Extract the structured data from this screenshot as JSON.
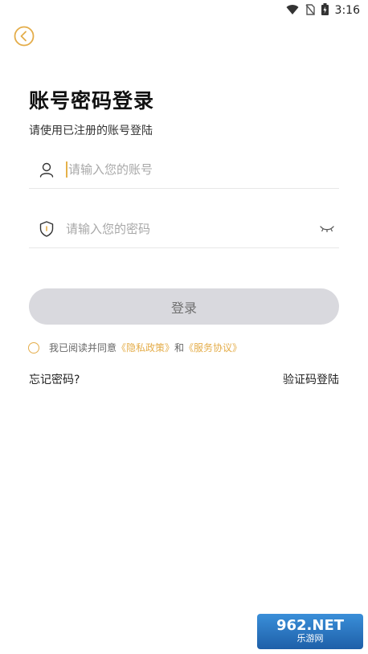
{
  "status_bar": {
    "time": "3:16",
    "icons": [
      "wifi-icon",
      "no-sim-icon",
      "battery-charging-icon"
    ]
  },
  "header": {
    "back_icon": "chevron-left-circle-icon"
  },
  "page": {
    "title": "账号密码登录",
    "subtitle": "请使用已注册的账号登陆"
  },
  "account_field": {
    "placeholder": "请输入您的账号",
    "value": "",
    "icon": "user-icon"
  },
  "password_field": {
    "placeholder": "请输入您的密码",
    "value": "",
    "icon": "shield-icon",
    "toggle_icon": "eye-closed-icon"
  },
  "login_button": {
    "label": "登录"
  },
  "agreement": {
    "prefix": "我已阅读并同意",
    "privacy_link": "《隐私政策》",
    "and": "和",
    "service_link": "《服务协议》",
    "checked": false
  },
  "footer_links": {
    "forgot": "忘记密码?",
    "sms_login": "验证码登陆"
  },
  "watermark": {
    "top": "962.NET",
    "bottom": "乐游网"
  },
  "colors": {
    "accent": "#e4ad4a",
    "button_bg": "#d9d9de",
    "button_text": "#6f6f6f"
  }
}
